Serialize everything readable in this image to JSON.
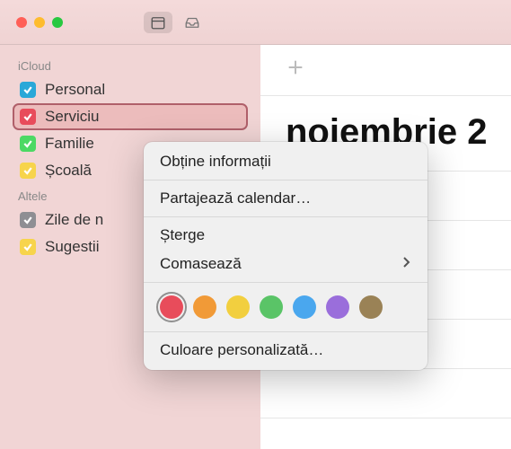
{
  "sidebar": {
    "sections": [
      {
        "label": "iCloud",
        "items": [
          {
            "name": "Personal",
            "color": "#2aa8d8",
            "checked": true,
            "selected": false
          },
          {
            "name": "Serviciu",
            "color": "#e84c5b",
            "checked": true,
            "selected": true
          },
          {
            "name": "Familie",
            "color": "#4cd964",
            "checked": true,
            "selected": false
          },
          {
            "name": "Școală",
            "color": "#f7d44c",
            "checked": true,
            "selected": false
          }
        ]
      },
      {
        "label": "Altele",
        "items": [
          {
            "name": "Zile de n",
            "color": "#8e8e93",
            "checked": true,
            "selected": false
          },
          {
            "name": "Sugestii",
            "color": "#f7d44c",
            "checked": true,
            "selected": false
          }
        ]
      }
    ]
  },
  "content": {
    "month": "noiembrie 2"
  },
  "menu": {
    "getInfo": "Obține informații",
    "share": "Partajează calendar…",
    "delete": "Șterge",
    "merge": "Comasează",
    "customColor": "Culoare personalizată…",
    "colors": [
      {
        "hex": "#e84c5b",
        "selected": true
      },
      {
        "hex": "#f19a37",
        "selected": false
      },
      {
        "hex": "#f2cf3f",
        "selected": false
      },
      {
        "hex": "#5ac467",
        "selected": false
      },
      {
        "hex": "#4aa7ee",
        "selected": false
      },
      {
        "hex": "#9a6edb",
        "selected": false
      },
      {
        "hex": "#9a8256",
        "selected": false
      }
    ]
  }
}
